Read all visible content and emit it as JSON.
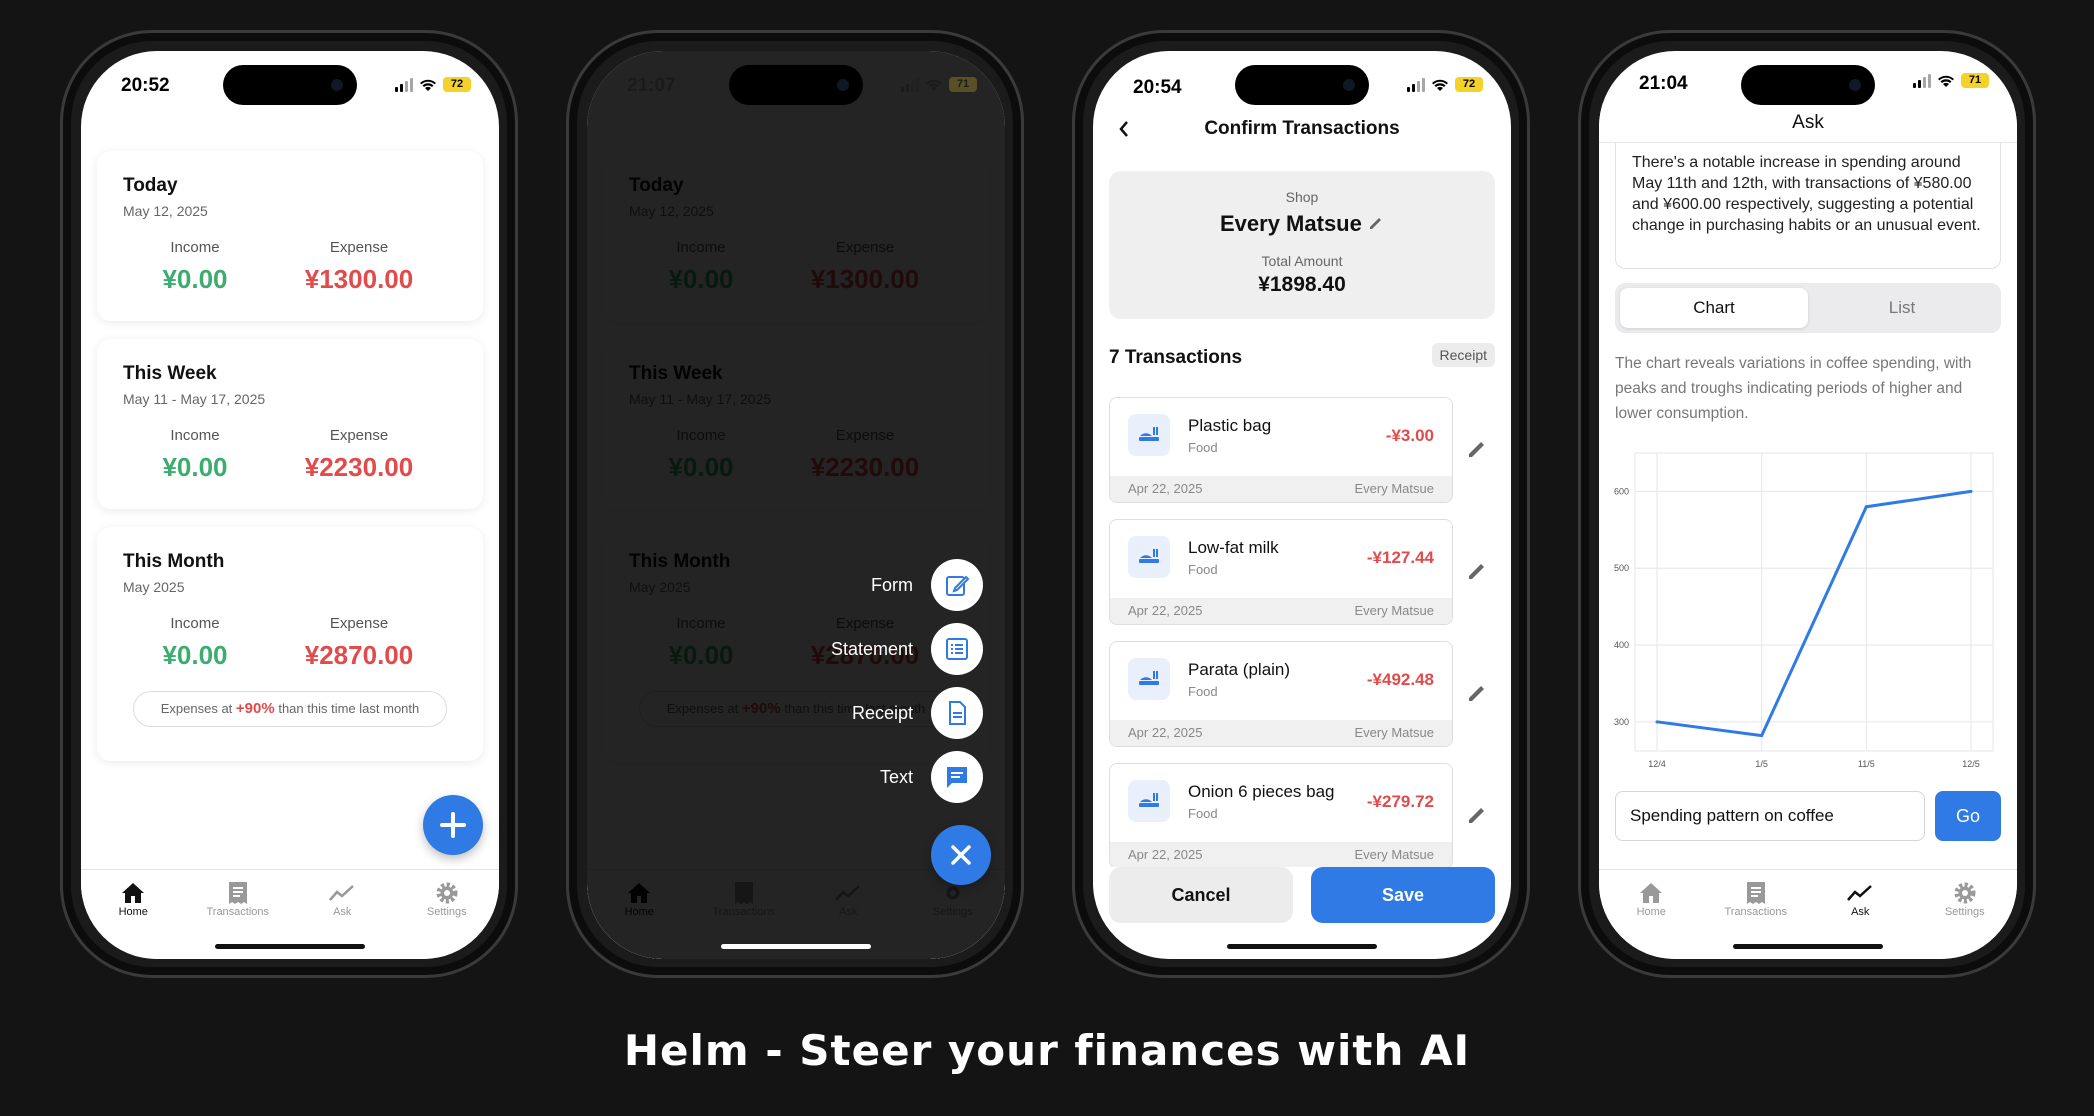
{
  "caption": "Helm - Steer your finances with AI",
  "colors": {
    "accent": "#2f7ae5",
    "income": "#3cad6e",
    "expense": "#e14b4b"
  },
  "phone1": {
    "status": {
      "time": "20:52",
      "battery": "72"
    },
    "cards": [
      {
        "title": "Today",
        "subtitle": "May 12, 2025",
        "income_label": "Income",
        "income": "¥0.00",
        "expense_label": "Expense",
        "expense": "¥1300.00"
      },
      {
        "title": "This Week",
        "subtitle": "May 11 - May 17, 2025",
        "income_label": "Income",
        "income": "¥0.00",
        "expense_label": "Expense",
        "expense": "¥2230.00"
      },
      {
        "title": "This Month",
        "subtitle": "May 2025",
        "income_label": "Income",
        "income": "¥0.00",
        "expense_label": "Expense",
        "expense": "¥2870.00"
      }
    ],
    "compare": {
      "prefix": "Expenses at",
      "percent": "+90%",
      "suffix": "than this time last month"
    },
    "fab_icon": "plus-icon",
    "tabs": [
      {
        "label": "Home",
        "icon": "home-icon"
      },
      {
        "label": "Transactions",
        "icon": "receipt-icon"
      },
      {
        "label": "Ask",
        "icon": "trend-icon"
      },
      {
        "label": "Settings",
        "icon": "gear-icon"
      }
    ]
  },
  "phone2": {
    "status": {
      "time": "21:07",
      "battery": "71"
    },
    "menu": [
      {
        "label": "Form",
        "icon": "edit-icon"
      },
      {
        "label": "Statement",
        "icon": "list-icon"
      },
      {
        "label": "Receipt",
        "icon": "document-icon"
      },
      {
        "label": "Text",
        "icon": "chat-icon"
      }
    ],
    "close_icon": "close-icon"
  },
  "phone3": {
    "status": {
      "time": "20:54",
      "battery": "72"
    },
    "title": "Confirm Transactions",
    "shop_label": "Shop",
    "shop_name": "Every Matsue",
    "total_label": "Total Amount",
    "total": "¥1898.40",
    "count_label": "7 Transactions",
    "receipt_button": "Receipt",
    "transactions": [
      {
        "name": "Plastic bag",
        "category": "Food",
        "amount": "-¥3.00",
        "date": "Apr 22, 2025",
        "shop": "Every Matsue"
      },
      {
        "name": "Low-fat milk",
        "category": "Food",
        "amount": "-¥127.44",
        "date": "Apr 22, 2025",
        "shop": "Every Matsue"
      },
      {
        "name": "Parata (plain)",
        "category": "Food",
        "amount": "-¥492.48",
        "date": "Apr 22, 2025",
        "shop": "Every Matsue"
      },
      {
        "name": "Onion 6 pieces bag",
        "category": "Food",
        "amount": "-¥279.72",
        "date": "Apr 22, 2025",
        "shop": "Every Matsue"
      }
    ],
    "cancel": "Cancel",
    "save": "Save"
  },
  "phone4": {
    "status": {
      "time": "21:04",
      "battery": "71"
    },
    "title": "Ask",
    "answer": "There's a notable increase in spending around May 11th and 12th, with transactions of ¥580.00 and ¥600.00 respectively, suggesting a potential change in purchasing habits or an unusual event.",
    "segments": {
      "chart": "Chart",
      "list": "List"
    },
    "summary": "The chart reveals variations in coffee spending, with peaks and troughs indicating periods of higher and lower consumption.",
    "query": "Spending pattern on coffee",
    "go": "Go",
    "tabs": [
      {
        "label": "Home",
        "icon": "home-icon"
      },
      {
        "label": "Transactions",
        "icon": "receipt-icon"
      },
      {
        "label": "Ask",
        "icon": "trend-icon"
      },
      {
        "label": "Settings",
        "icon": "gear-icon"
      }
    ]
  },
  "chart_data": {
    "type": "line",
    "x": [
      "12/4",
      "1/5",
      "11/5",
      "12/5"
    ],
    "values": [
      300,
      282,
      580,
      600
    ],
    "yticks": [
      300,
      400,
      500,
      600
    ],
    "ylim": [
      262,
      650
    ],
    "grid": true,
    "color": "#2f7ae5",
    "title": "",
    "xlabel": "",
    "ylabel": ""
  }
}
